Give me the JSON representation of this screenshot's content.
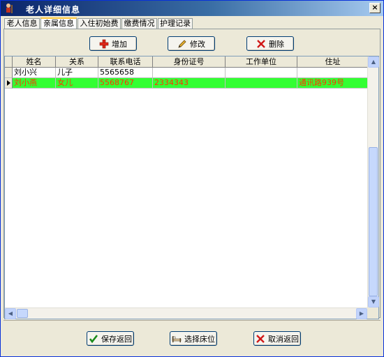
{
  "window": {
    "title": "老人详细信息",
    "close_label": "×"
  },
  "tabs": [
    {
      "label": "老人信息"
    },
    {
      "label": "亲属信息"
    },
    {
      "label": "入住初始费"
    },
    {
      "label": "缴费情况"
    },
    {
      "label": "护理记录"
    }
  ],
  "active_tab": "亲属信息",
  "toolbar": {
    "add_label": "增加",
    "edit_label": "修改",
    "delete_label": "删除"
  },
  "grid": {
    "columns": [
      "姓名",
      "关系",
      "联系电话",
      "身份证号",
      "工作单位",
      "住址"
    ],
    "rows": [
      {
        "name": "刘小兴",
        "relation": "儿子",
        "phone": "5565658",
        "id_number": "",
        "workplace": "",
        "address": ""
      },
      {
        "name": "刘小燕",
        "relation": "女儿",
        "phone": "5568767",
        "id_number": "2334343",
        "workplace": "",
        "address": "通讯路939号"
      }
    ],
    "selected_row": 2
  },
  "footer": {
    "save_label": "保存返回",
    "bed_label": "选择床位",
    "cancel_label": "取消返回"
  },
  "colors": {
    "selected_row_bg": "#33ff33",
    "selected_row_text": "#ff3300",
    "title_bar": "#0a246a"
  }
}
